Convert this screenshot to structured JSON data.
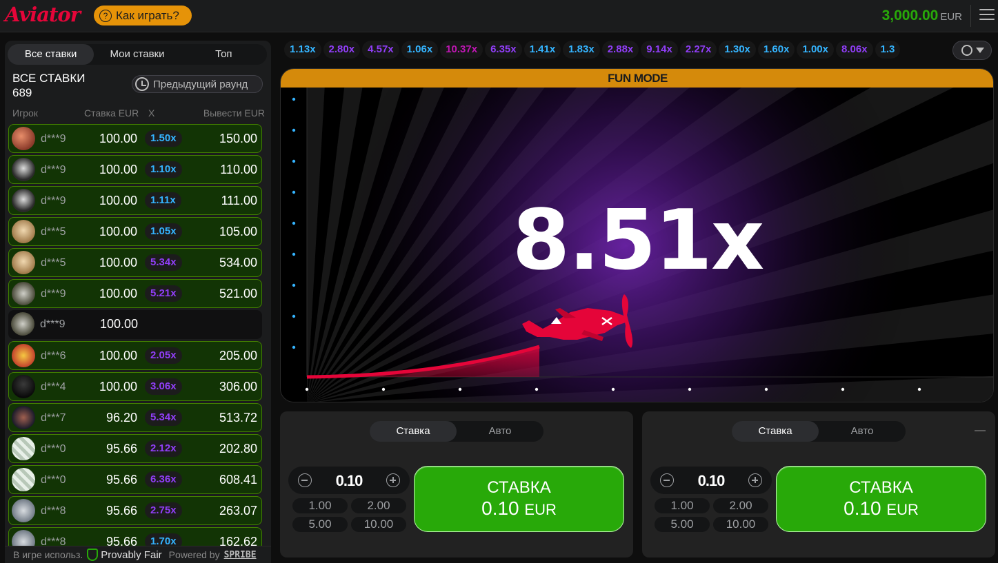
{
  "header": {
    "logo": "Aviator",
    "how_to_play": "Как играть?",
    "balance": "3,000.00",
    "currency": "EUR"
  },
  "bets_panel": {
    "tabs": [
      {
        "label": "Все ставки",
        "active": true
      },
      {
        "label": "Мои ставки",
        "active": false
      },
      {
        "label": "Топ",
        "active": false
      }
    ],
    "title": "ВСЕ СТАВКИ",
    "count": "689",
    "previous_round": "Предыдущий раунд",
    "columns": {
      "player": "Игрок",
      "bet": "Ставка EUR",
      "x": "X",
      "cashout": "Вывести EUR"
    },
    "rows": [
      {
        "avatar": "dragon",
        "player": "d***9",
        "bet": "100.00",
        "mult": "1.50x",
        "mult_color": "#34b4ff",
        "cashout": "150.00",
        "won": true
      },
      {
        "avatar": "dog",
        "player": "d***9",
        "bet": "100.00",
        "mult": "1.10x",
        "mult_color": "#34b4ff",
        "cashout": "110.00",
        "won": true
      },
      {
        "avatar": "dog",
        "player": "d***9",
        "bet": "100.00",
        "mult": "1.11x",
        "mult_color": "#34b4ff",
        "cashout": "111.00",
        "won": true
      },
      {
        "avatar": "lion",
        "player": "d***5",
        "bet": "100.00",
        "mult": "1.05x",
        "mult_color": "#34b4ff",
        "cashout": "105.00",
        "won": true
      },
      {
        "avatar": "lion",
        "player": "d***5",
        "bet": "100.00",
        "mult": "5.34x",
        "mult_color": "#913ef8",
        "cashout": "534.00",
        "won": true
      },
      {
        "avatar": "raccoon",
        "player": "d***9",
        "bet": "100.00",
        "mult": "5.21x",
        "mult_color": "#913ef8",
        "cashout": "521.00",
        "won": true
      },
      {
        "avatar": "raccoon",
        "player": "d***9",
        "bet": "100.00",
        "mult": "",
        "mult_color": "",
        "cashout": "",
        "won": false
      },
      {
        "avatar": "cat",
        "player": "d***6",
        "bet": "100.00",
        "mult": "2.05x",
        "mult_color": "#913ef8",
        "cashout": "205.00",
        "won": true
      },
      {
        "avatar": "dark",
        "player": "d***4",
        "bet": "100.00",
        "mult": "3.06x",
        "mult_color": "#913ef8",
        "cashout": "306.00",
        "won": true
      },
      {
        "avatar": "bike",
        "player": "d***7",
        "bet": "96.20",
        "mult": "5.34x",
        "mult_color": "#913ef8",
        "cashout": "513.72",
        "won": true
      },
      {
        "avatar": "money",
        "player": "d***0",
        "bet": "95.66",
        "mult": "2.12x",
        "mult_color": "#913ef8",
        "cashout": "202.80",
        "won": true
      },
      {
        "avatar": "money",
        "player": "d***0",
        "bet": "95.66",
        "mult": "6.36x",
        "mult_color": "#913ef8",
        "cashout": "608.41",
        "won": true
      },
      {
        "avatar": "plane",
        "player": "d***8",
        "bet": "95.66",
        "mult": "2.75x",
        "mult_color": "#913ef8",
        "cashout": "263.07",
        "won": true
      },
      {
        "avatar": "plane",
        "player": "d***8",
        "bet": "95.66",
        "mult": "1.70x",
        "mult_color": "#34b4ff",
        "cashout": "162.62",
        "won": true
      }
    ]
  },
  "footer": {
    "in_game": "В игре использ.",
    "provably_fair": "Provably Fair",
    "powered_by": "Powered by",
    "brand": "SPRIBE"
  },
  "history": [
    {
      "value": "1.13x",
      "color": "#34b4ff"
    },
    {
      "value": "2.80x",
      "color": "#913ef8"
    },
    {
      "value": "4.57x",
      "color": "#913ef8"
    },
    {
      "value": "1.06x",
      "color": "#34b4ff"
    },
    {
      "value": "10.37x",
      "color": "#c017b4"
    },
    {
      "value": "6.35x",
      "color": "#913ef8"
    },
    {
      "value": "1.41x",
      "color": "#34b4ff"
    },
    {
      "value": "1.83x",
      "color": "#34b4ff"
    },
    {
      "value": "2.88x",
      "color": "#913ef8"
    },
    {
      "value": "9.14x",
      "color": "#913ef8"
    },
    {
      "value": "2.27x",
      "color": "#913ef8"
    },
    {
      "value": "1.30x",
      "color": "#34b4ff"
    },
    {
      "value": "1.60x",
      "color": "#34b4ff"
    },
    {
      "value": "1.00x",
      "color": "#34b4ff"
    },
    {
      "value": "8.06x",
      "color": "#913ef8"
    },
    {
      "value": "1.3",
      "color": "#34b4ff"
    }
  ],
  "game": {
    "mode_banner": "FUN MODE",
    "multiplier": "8.51x",
    "accent": "#e50539"
  },
  "bet_panels": [
    {
      "tabs": [
        {
          "label": "Ставка",
          "active": true
        },
        {
          "label": "Авто",
          "active": false
        }
      ],
      "amount": "0.10",
      "quick": [
        "1.00",
        "2.00",
        "5.00",
        "10.00"
      ],
      "button_label": "СТАВКА",
      "button_amount": "0.10",
      "button_currency": "EUR",
      "removable": false
    },
    {
      "tabs": [
        {
          "label": "Ставка",
          "active": true
        },
        {
          "label": "Авто",
          "active": false
        }
      ],
      "amount": "0.10",
      "quick": [
        "1.00",
        "2.00",
        "5.00",
        "10.00"
      ],
      "button_label": "СТАВКА",
      "button_amount": "0.10",
      "button_currency": "EUR",
      "removable": true
    }
  ]
}
